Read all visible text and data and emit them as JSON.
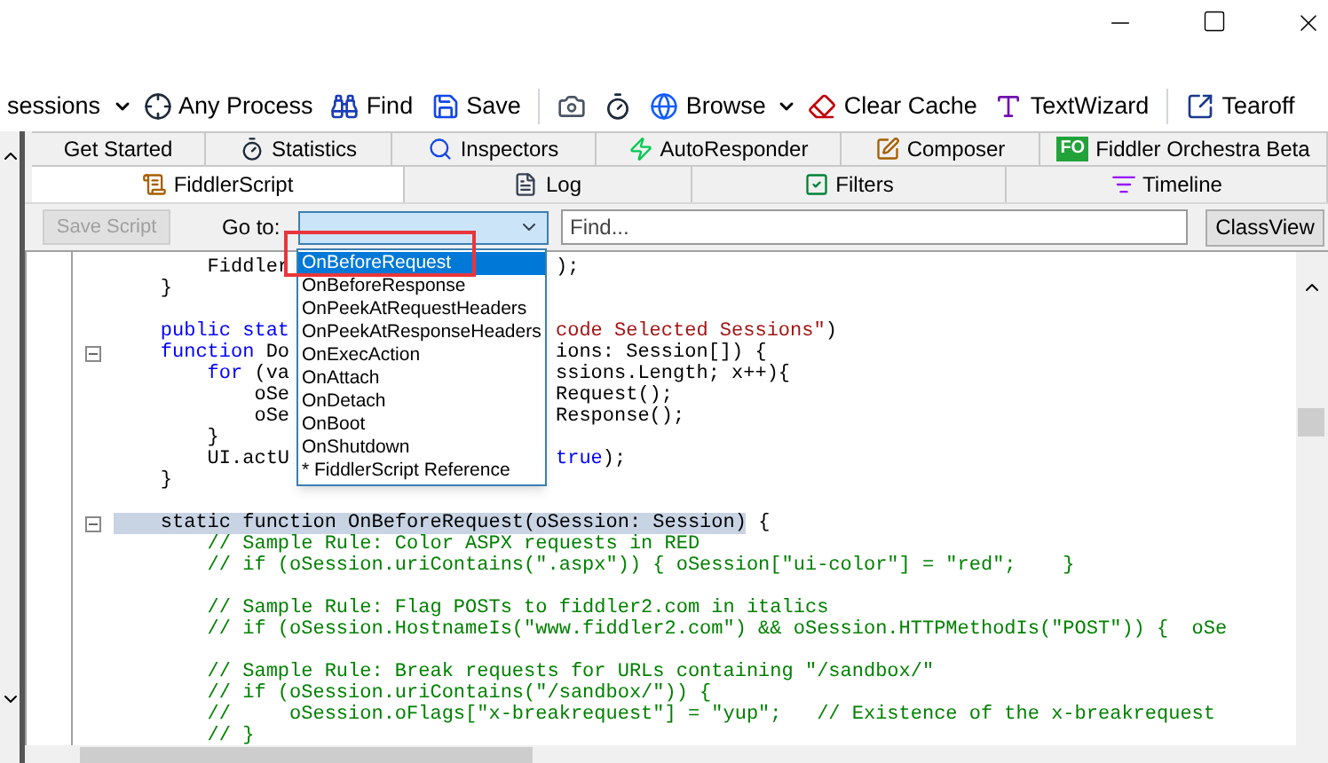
{
  "toolbar": [
    {
      "kind": "text",
      "label": "sessions"
    },
    {
      "kind": "caret"
    },
    {
      "kind": "process",
      "label": "Any Process"
    },
    {
      "kind": "find",
      "label": "Find"
    },
    {
      "kind": "save",
      "label": "Save"
    },
    {
      "kind": "sep"
    },
    {
      "kind": "camera"
    },
    {
      "kind": "timer"
    },
    {
      "kind": "browse",
      "label": "Browse"
    },
    {
      "kind": "caret"
    },
    {
      "kind": "cache",
      "label": "Clear Cache"
    },
    {
      "kind": "wizard",
      "label": "TextWizard"
    },
    {
      "kind": "sep"
    },
    {
      "kind": "tearoff",
      "label": "Tearoff"
    }
  ],
  "tabs_row1": [
    {
      "kind": "start",
      "label": "Get Started",
      "selected": false
    },
    {
      "kind": "stats",
      "label": "Statistics",
      "selected": false
    },
    {
      "kind": "inspect",
      "label": "Inspectors",
      "selected": false
    },
    {
      "kind": "auto",
      "label": "AutoResponder",
      "selected": false
    },
    {
      "kind": "compose",
      "label": "Composer",
      "selected": false
    },
    {
      "kind": "orchestra",
      "badge": "FO",
      "label": "Fiddler Orchestra Beta",
      "selected": false
    }
  ],
  "tabs_row2": [
    {
      "kind": "script",
      "label": "FiddlerScript",
      "selected": true
    },
    {
      "kind": "log",
      "label": "Log",
      "selected": false
    },
    {
      "kind": "filters",
      "label": "Filters",
      "selected": false
    },
    {
      "kind": "timeline",
      "label": "Timeline",
      "selected": false
    }
  ],
  "script_bar": {
    "save_button": {
      "label": "Save Script",
      "disabled": true
    },
    "goto_label": "Go to:",
    "find": {
      "placeholder": "Find..."
    },
    "classview_button": "ClassView"
  },
  "goto_dropdown": {
    "expanded": true,
    "items": [
      {
        "label": "OnBeforeRequest",
        "selected": true
      },
      {
        "label": "OnBeforeResponse",
        "selected": false
      },
      {
        "label": "OnPeekAtRequestHeaders",
        "selected": false
      },
      {
        "label": "OnPeekAtResponseHeaders",
        "selected": false
      },
      {
        "label": "OnExecAction",
        "selected": false
      },
      {
        "label": "OnAttach",
        "selected": false
      },
      {
        "label": "OnDetach",
        "selected": false
      },
      {
        "label": "OnBoot",
        "selected": false
      },
      {
        "label": "OnShutdown",
        "selected": false
      },
      {
        "label": "* FiddlerScript Reference",
        "selected": false
      }
    ]
  },
  "code_lines": [
    {
      "fold": false,
      "left": [
        {
          "text": "        Fiddler",
          "kind": "plain"
        }
      ],
      "right": [
        {
          "text": ");",
          "kind": "plain"
        }
      ]
    },
    {
      "fold": false,
      "left": [
        {
          "text": "    }",
          "kind": "plain"
        }
      ]
    },
    {
      "fold": false
    },
    {
      "fold": false,
      "left": [
        {
          "text": "    public stat",
          "kind": "keyword"
        }
      ],
      "right": [
        {
          "text": "code Selected Sessions\"",
          "kind": "string"
        },
        {
          "text": ")",
          "kind": "plain"
        }
      ]
    },
    {
      "fold": true,
      "left": [
        {
          "text": "    function",
          "kind": "keyword"
        },
        {
          "text": " Do",
          "kind": "plain"
        }
      ],
      "right": [
        {
          "text": "ions: Session[]) {",
          "kind": "plain"
        }
      ]
    },
    {
      "fold": false,
      "left": [
        {
          "text": "        for",
          "kind": "keyword"
        },
        {
          "text": " (va",
          "kind": "plain"
        }
      ],
      "right": [
        {
          "text": "ssions.Length; x++){",
          "kind": "plain"
        }
      ]
    },
    {
      "fold": false,
      "left": [
        {
          "text": "            oSe",
          "kind": "plain"
        }
      ],
      "right": [
        {
          "text": "Request();",
          "kind": "plain"
        }
      ]
    },
    {
      "fold": false,
      "left": [
        {
          "text": "            oSe",
          "kind": "plain"
        }
      ],
      "right": [
        {
          "text": "Response();",
          "kind": "plain"
        }
      ]
    },
    {
      "fold": false,
      "left": [
        {
          "text": "        }",
          "kind": "plain"
        }
      ]
    },
    {
      "fold": false,
      "left": [
        {
          "text": "        UI.actU",
          "kind": "plain"
        }
      ],
      "right": [
        {
          "text": "true",
          "kind": "keyword"
        },
        {
          "text": ");",
          "kind": "plain"
        }
      ]
    },
    {
      "fold": false,
      "left": [
        {
          "text": "    }",
          "kind": "plain"
        }
      ]
    },
    {
      "fold": false
    },
    {
      "fold": true,
      "left": [
        {
          "text": "    static function OnBeforeRequest(oSession: Session)",
          "kind": "selection"
        },
        {
          "text": " {",
          "kind": "plain"
        }
      ]
    },
    {
      "fold": false,
      "left": [
        {
          "text": "        // Sample Rule: Color ASPX requests in RED",
          "kind": "comment"
        }
      ]
    },
    {
      "fold": false,
      "left": [
        {
          "text": "        // if (oSession.uriContains(\".aspx\")) { oSession[\"ui-color\"] = \"red\";    }",
          "kind": "comment"
        }
      ]
    },
    {
      "fold": false
    },
    {
      "fold": false,
      "left": [
        {
          "text": "        // Sample Rule: Flag POSTs to fiddler2.com in italics",
          "kind": "comment"
        }
      ]
    },
    {
      "fold": false,
      "left": [
        {
          "text": "        // if (oSession.HostnameIs(\"www.fiddler2.com\") && oSession.HTTPMethodIs(\"POST\")) {  oSe",
          "kind": "comment"
        }
      ]
    },
    {
      "fold": false
    },
    {
      "fold": false,
      "left": [
        {
          "text": "        // Sample Rule: Break requests for URLs containing \"/sandbox/\"",
          "kind": "comment"
        }
      ]
    },
    {
      "fold": false,
      "left": [
        {
          "text": "        // if (oSession.uriContains(\"/sandbox/\")) {",
          "kind": "comment"
        }
      ]
    },
    {
      "fold": false,
      "left": [
        {
          "text": "        //     oSession.oFlags[\"x-breakrequest\"] = \"yup\";   // Existence of the x-breakrequest",
          "kind": "comment"
        }
      ]
    },
    {
      "fold": false,
      "left": [
        {
          "text": "        // }",
          "kind": "comment"
        }
      ]
    }
  ]
}
